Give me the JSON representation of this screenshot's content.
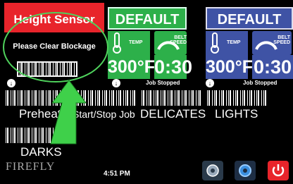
{
  "height_sensor": {
    "title": "Height Sensor",
    "message": "Please Clear Blockage"
  },
  "programs": [
    {
      "name": "DEFAULT",
      "temp_label": "TEMP",
      "belt_label": "BELT SPEED",
      "temp": "300°F",
      "time": "0:30",
      "status": "Job Stopped",
      "color": "#2db04a"
    },
    {
      "name": "DEFAULT",
      "temp_label": "TEMP",
      "belt_label": "BELT SPEED",
      "temp": "300°F",
      "time": "0:30",
      "status": "Job Stopped",
      "color": "#3f53a5"
    }
  ],
  "bottom_programs": {
    "preheat": "Preheat",
    "start_stop": "Start/Stop Job",
    "delicates": "DELICATES",
    "lights": "LIGHTS",
    "darks": "DARKS"
  },
  "status_bar": {
    "clock": "4:51 PM",
    "logo": "FIREFLY"
  },
  "colors": {
    "alert": "#e8242b",
    "green": "#2db04a",
    "blue": "#3f53a5",
    "annotation": "#3fd04a"
  }
}
